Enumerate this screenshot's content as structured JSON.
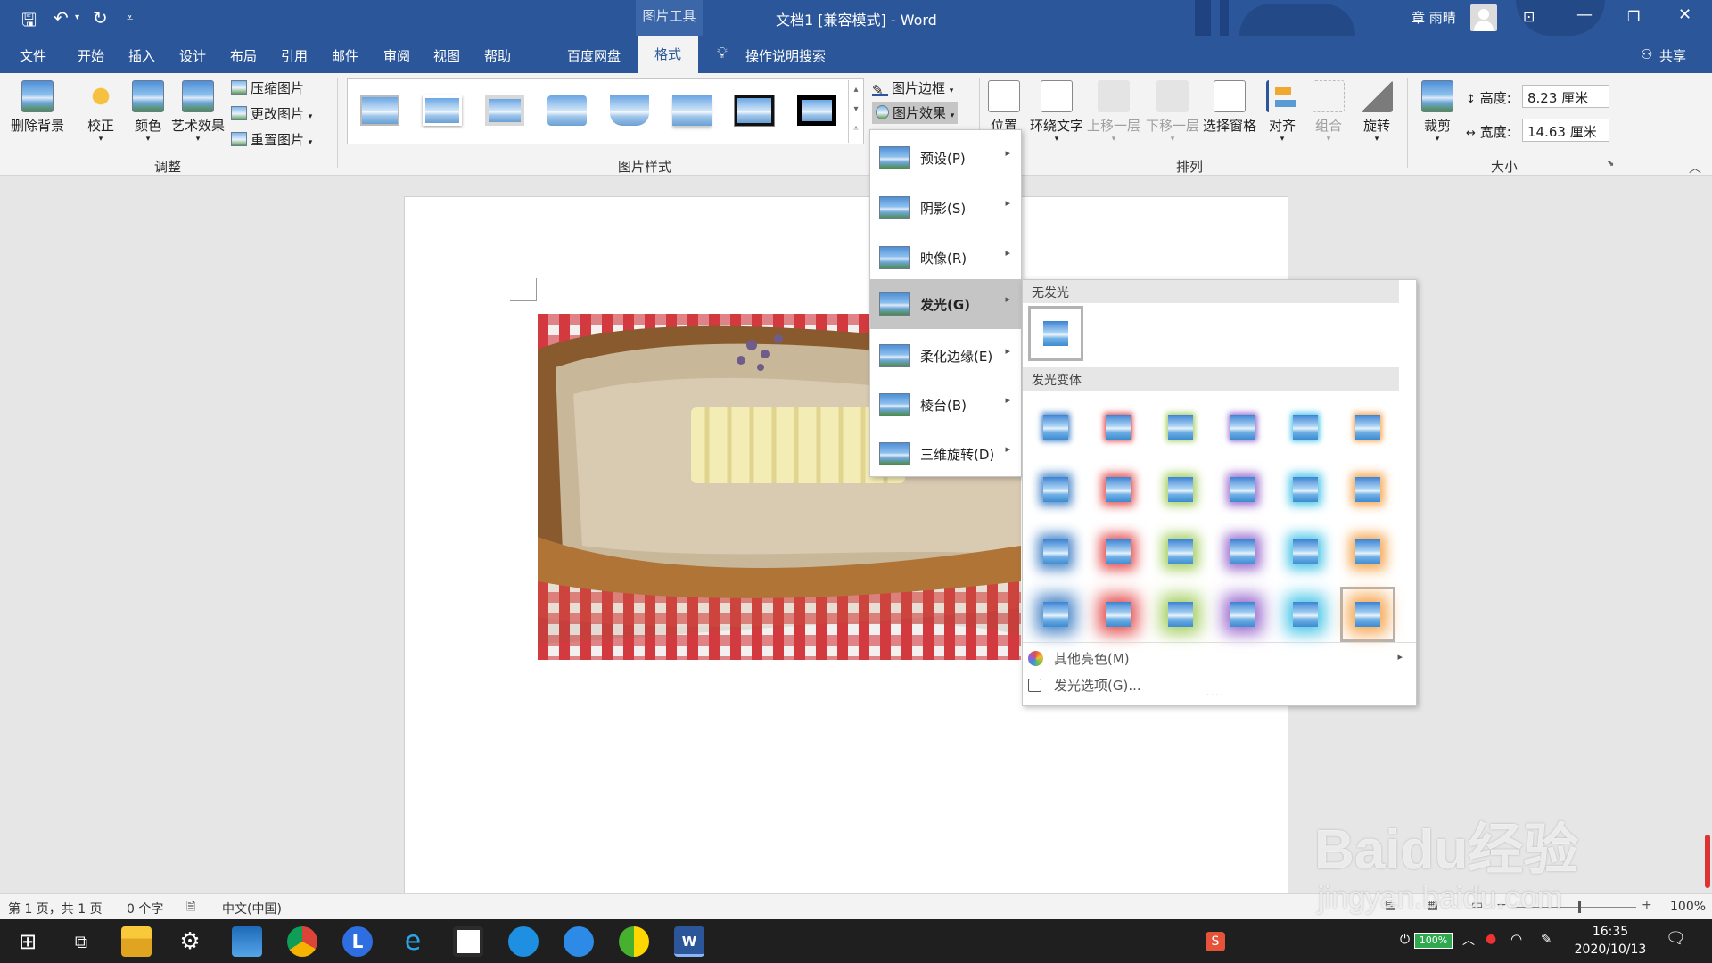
{
  "titlebar": {
    "picture_tools": "图片工具",
    "doc_title": "文档1 [兼容模式] - Word",
    "user": "章 雨晴",
    "qa_more": "=",
    "undo_icon": "undo-icon",
    "save_icon": "save-icon"
  },
  "tabs": [
    "文件",
    "开始",
    "插入",
    "设计",
    "布局",
    "引用",
    "邮件",
    "审阅",
    "视图",
    "帮助",
    "百度网盘"
  ],
  "active_tab": "格式",
  "tell_me": "操作说明搜索",
  "share": "共享",
  "ribbon": {
    "remove_bg": "删除背景",
    "correct": "校正",
    "color": "颜色",
    "artistic": "艺术效果",
    "compress": "压缩图片",
    "change": "更改图片",
    "reset": "重置图片",
    "group_adjust": "调整",
    "group_styles": "图片样式",
    "border": "图片边框",
    "effects": "图片效果",
    "position": "位置",
    "wrap": "环绕文字",
    "forward": "上移一层",
    "backward": "下移一层",
    "selection_pane": "选择窗格",
    "align": "对齐",
    "group": "组合",
    "rotate": "旋转",
    "group_arrange": "排列",
    "crop": "裁剪",
    "height_label": "高度:",
    "height_val": "8.23 厘米",
    "width_label": "宽度:",
    "width_val": "14.63 厘米",
    "group_size": "大小"
  },
  "effects_menu": [
    {
      "label": "预设(P)"
    },
    {
      "label": "阴影(S)"
    },
    {
      "label": "映像(R)"
    },
    {
      "label": "发光(G)"
    },
    {
      "label": "柔化边缘(E)"
    },
    {
      "label": "棱台(B)"
    },
    {
      "label": "三维旋转(D)"
    }
  ],
  "glow": {
    "none_header": "无发光",
    "variants_header": "发光变体",
    "more_colors": "其他亮色(M)",
    "options": "发光选项(G)...",
    "dots": "....",
    "colors": [
      "#4a86c8",
      "#e55050",
      "#a6d063",
      "#9b6ccf",
      "#4bc6e8",
      "#f6a54e"
    ],
    "selected_row": 4,
    "selected_col": 6
  },
  "status": {
    "page": "第 1 页，共 1 页",
    "words": "0 个字",
    "lang": "中文(中国)",
    "zoom": "100%"
  },
  "taskbar": {
    "time": "16:35",
    "date": "2020/10/13",
    "battery": "100%"
  },
  "watermark": {
    "brand": "Baidu经验",
    "url": "jingyan.baidu.com"
  }
}
